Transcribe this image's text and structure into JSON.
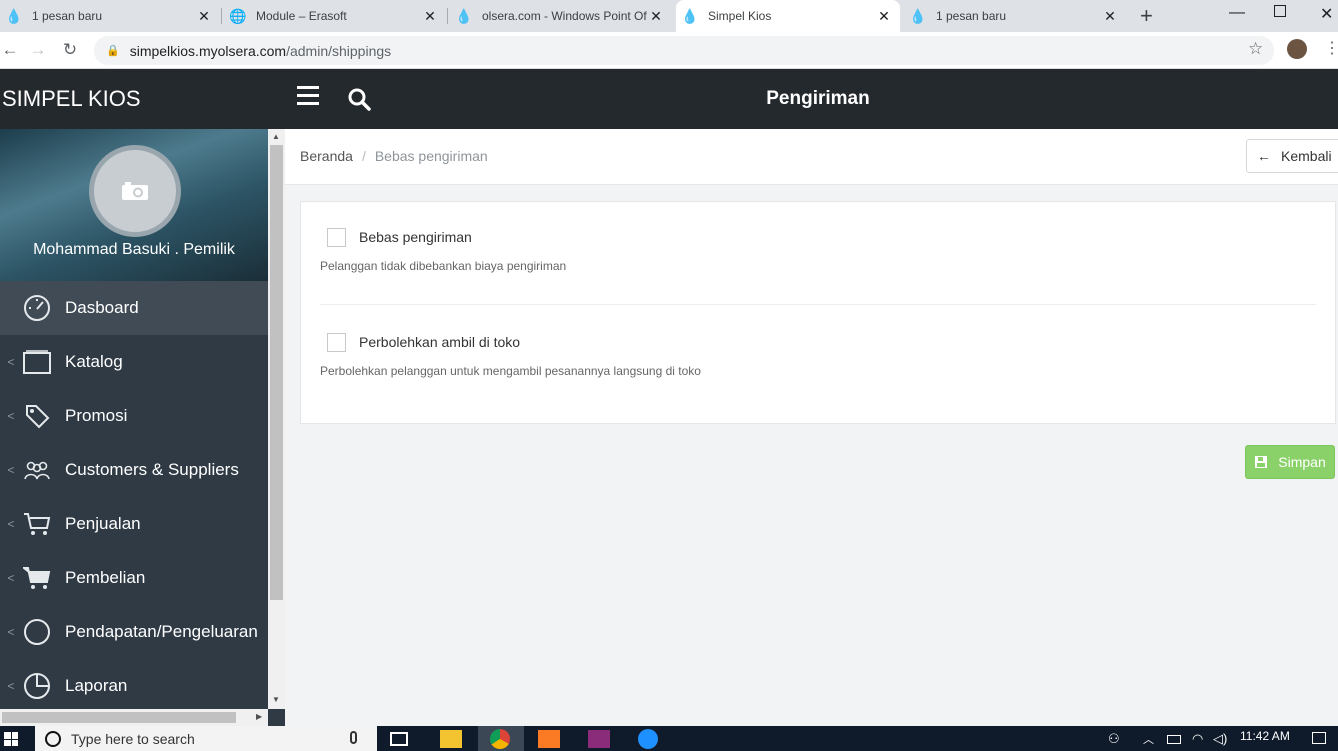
{
  "browser": {
    "tabs": [
      {
        "title": "1 pesan baru",
        "icon": "olsera-icon"
      },
      {
        "title": "Module – Erasoft",
        "icon": "globe-icon"
      },
      {
        "title": "olsera.com - Windows Point Of",
        "icon": "olsera-icon"
      },
      {
        "title": "Simpel Kios",
        "icon": "olsera-icon",
        "active": true
      },
      {
        "title": "1 pesan baru",
        "icon": "olsera-icon"
      }
    ],
    "new_tab": "+",
    "url_host": "simpelkios.myolsera.com",
    "url_path": "/admin/shippings",
    "window_controls": [
      "minimize",
      "maximize",
      "close"
    ]
  },
  "app": {
    "brand": "SIMPEL KIOS",
    "user": "Mohammad Basuki . Pemilik",
    "menu": [
      {
        "label": "Dasboard",
        "icon": "dashboard-gauge-icon",
        "active": true
      },
      {
        "label": "Katalog",
        "icon": "catalog-icon"
      },
      {
        "label": "Promosi",
        "icon": "tag-icon"
      },
      {
        "label": "Customers & Suppliers",
        "icon": "users-icon"
      },
      {
        "label": "Penjualan",
        "icon": "cart-icon"
      },
      {
        "label": "Pembelian",
        "icon": "cart-filled-icon"
      },
      {
        "label": "Pendapatan/Pengeluaran",
        "icon": "circle-icon"
      },
      {
        "label": "Laporan",
        "icon": "pie-chart-icon"
      }
    ]
  },
  "header": {
    "title": "Pengiriman"
  },
  "breadcrumb": {
    "home": "Beranda",
    "separator": "/",
    "current": "Bebas pengiriman"
  },
  "back_button": {
    "arrow": "←",
    "label": "Kembali"
  },
  "options": [
    {
      "label": "Bebas pengiriman",
      "help": "Pelanggan tidak dibebankan biaya pengiriman",
      "checked": false
    },
    {
      "label": "Perbolehkan ambil di toko",
      "help": "Perbolehkan pelanggan untuk mengambil pesanannya langsung di toko",
      "checked": false
    }
  ],
  "save_button": {
    "label": "Simpan"
  },
  "taskbar": {
    "search_placeholder": "Type here to search",
    "time": "11:42 AM"
  },
  "colors": {
    "sidebar": "#2f3a45",
    "header": "#24292e",
    "save": "#8bd16a"
  }
}
